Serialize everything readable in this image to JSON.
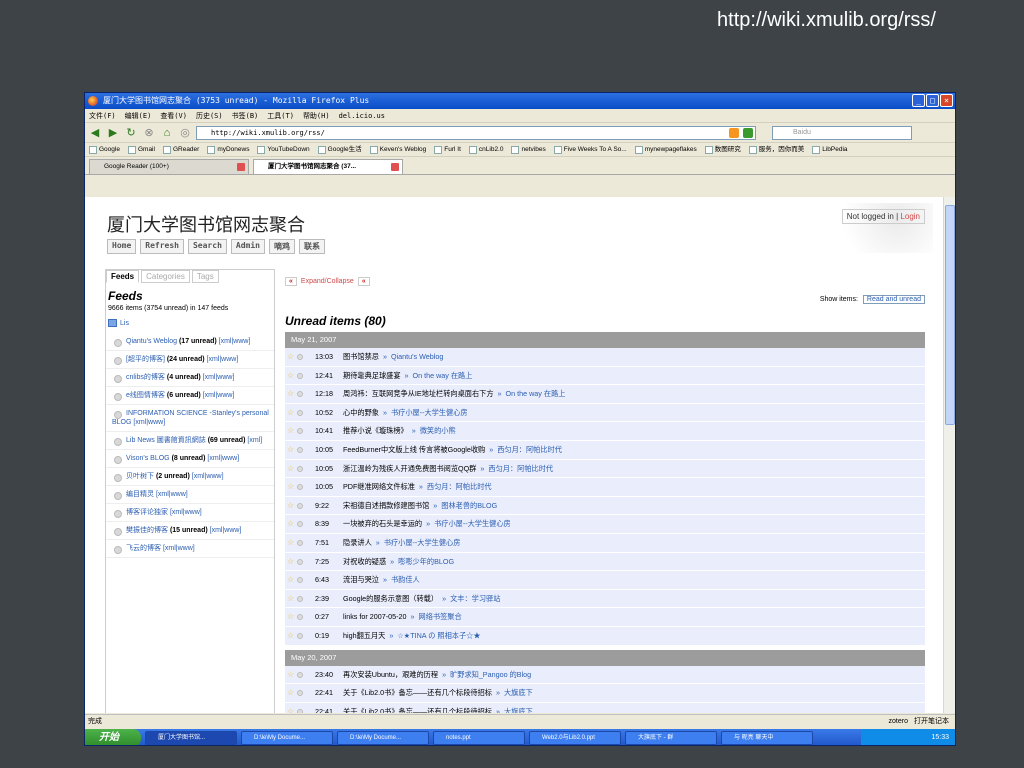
{
  "slide_caption": "http://wiki.xmulib.org/rss/",
  "window": {
    "title": "厦门大学图书馆网志聚合 (3753 unread) - Mozilla Firefox Plus"
  },
  "menu": [
    "文件(F)",
    "编辑(E)",
    "查看(V)",
    "历史(S)",
    "书签(B)",
    "工具(T)",
    "帮助(H)",
    "del.icio.us"
  ],
  "nav": {
    "url": "http://wiki.xmulib.org/rss/",
    "search_placeholder": "Baidu"
  },
  "bookmarks": [
    "Google",
    "Gmail",
    "GReader",
    "myDonews",
    "YouTubeDown",
    "Google生活",
    "Keven's Weblog",
    "Furl It",
    "cnLib2.0",
    "netvibes",
    "Five Weeks To A So...",
    "mynewpageflakes",
    "数图研究",
    "服务，因你而美",
    "LibPedia"
  ],
  "tabs": [
    {
      "label": "Google Reader (100+)"
    },
    {
      "label": "厦门大学图书馆网志聚合 (37..."
    }
  ],
  "page": {
    "title": "厦门大学图书馆网志聚合",
    "nav": [
      "Home",
      "Refresh",
      "Search",
      "Admin",
      "嘀鸡",
      "联系"
    ],
    "login_text": "Not logged in |",
    "login_link": "Login"
  },
  "sidebar": {
    "tabs": [
      "Feeds",
      "Categories",
      "Tags"
    ],
    "heading": "Feeds",
    "summary": "9666 items (3754 unread) in 147 feeds",
    "folder": "Lis",
    "feeds": [
      {
        "name": "Qiantu's Weblog",
        "count": "(17 unread)",
        "links": "[xml|www]"
      },
      {
        "name": "[超平的博客]",
        "count": "(24 unread)",
        "links": "[xml|www]"
      },
      {
        "name": "cnlibs的博客",
        "count": "(4 unread)",
        "links": "[xml|www]"
      },
      {
        "name": "e线图情博客",
        "count": "(6 unread)",
        "links": "[xml|www]"
      },
      {
        "name": "INFORMATION SCIENCE -Stanley's personal BLOG",
        "count": "",
        "links": "[xml|www]"
      },
      {
        "name": "Lib News 圖書館資訊網誌",
        "count": "(69 unread)",
        "links": "[xml]"
      },
      {
        "name": "Vison's BLOG",
        "count": "(8 unread)",
        "links": "[xml|www]"
      },
      {
        "name": "贝叶树下",
        "count": "(2 unread)",
        "links": "[xml|www]"
      },
      {
        "name": "编目精灵",
        "count": "",
        "links": "[xml|www]"
      },
      {
        "name": "博客评论独家",
        "count": "",
        "links": "[xml|www]"
      },
      {
        "name": "樊振佳的博客",
        "count": "(15 unread)",
        "links": "[xml|www]"
      },
      {
        "name": "飞云的博客",
        "count": "",
        "links": "[xml|www]"
      }
    ]
  },
  "main": {
    "expand_label": "Expand/Collapse",
    "show_items_label": "Show items:",
    "show_items_value": "Read and unread",
    "heading": "Unread items (80)",
    "days": [
      {
        "date": "May 21, 2007",
        "items": [
          {
            "time": "13:03",
            "title": "图书馆禁忌",
            "source": "Qiantu's Weblog"
          },
          {
            "time": "12:41",
            "title": "期待靠典足球盛宴",
            "source": "On the way 在路上"
          },
          {
            "time": "12:18",
            "title": "周鸿祎：互联网竞争从IE地址栏转向桌面右下方",
            "source": "On the way 在路上"
          },
          {
            "time": "10:52",
            "title": "心中的野象",
            "source": "书疗小屋--大学生健心房"
          },
          {
            "time": "10:41",
            "title": "推荐小说《璇珠榜》",
            "source": "微笑的小熊"
          },
          {
            "time": "10:05",
            "title": "FeedBurner中文版上线 传言将被Google收购",
            "source": "西匀月：阿帕比时代"
          },
          {
            "time": "10:05",
            "title": "浙江温岭为残疾人开通免费图书阅览QQ群",
            "source": "西匀月：阿帕比时代"
          },
          {
            "time": "10:05",
            "title": "PDF继准网络文件标准",
            "source": "西匀月：阿帕比时代"
          },
          {
            "time": "9:22",
            "title": "宋祖德自述捐款修建图书馆",
            "source": "图林老兽的BLOG"
          },
          {
            "time": "8:39",
            "title": "一块被弃的石头是幸运的",
            "source": "书疗小屋--大学生健心房"
          },
          {
            "time": "7:51",
            "title": "隐录讲人",
            "source": "书疗小屋--大学生健心房"
          },
          {
            "time": "7:25",
            "title": "对祝收的疑惑",
            "source": "嘭嘭少年的BLOG"
          },
          {
            "time": "6:43",
            "title": "流泪与哭泣",
            "source": "书韵佳人"
          },
          {
            "time": "2:39",
            "title": "Google的服务示意图（转载）",
            "source": "文丰：学习驿站"
          },
          {
            "time": "0:27",
            "title": "links for 2007-05-20",
            "source": "网络书签聚合"
          },
          {
            "time": "0:19",
            "title": "high翻五月天",
            "source": "☆★TINA の 照相本子☆★"
          }
        ]
      },
      {
        "date": "May 20, 2007",
        "items": [
          {
            "time": "23:40",
            "title": "再次安装Ubuntu，艰难的历程",
            "source": "旷野求知_Pangoo 的Blog"
          },
          {
            "time": "22:41",
            "title": "关于《Lib2.0书》备忘——还有几个标段待招标",
            "source": "大旗底下"
          },
          {
            "time": "22:41",
            "title": "关于《Lib2.0书》备忘——还有几个标段待招标",
            "source": "大旗底下"
          }
        ]
      }
    ]
  },
  "status": {
    "text": "完成",
    "zotero": "zotero",
    "notebook": "打开笔记本"
  },
  "taskbar": {
    "start": "开始",
    "tasks": [
      "厦门大学图书馆...",
      "D:\\le\\My Docume...",
      "D:\\le\\My Docume...",
      "notes.ppt",
      "Web2.0与Lib2.0.ppt",
      "大旗底下 - 群",
      "与 昵亮 聊天中"
    ],
    "clock": "15:33"
  }
}
